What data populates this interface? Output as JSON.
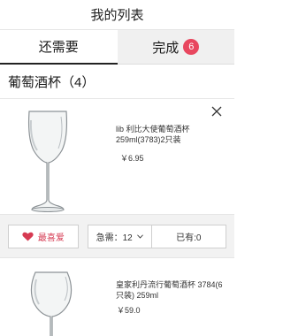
{
  "header": {
    "title": "我的列表"
  },
  "tabs": [
    {
      "label": "还需要",
      "active": true
    },
    {
      "label": "完成",
      "badge": "6",
      "active": false
    }
  ],
  "section": {
    "title": "葡萄酒杯（4）"
  },
  "items": [
    {
      "name": "lib 利比大使葡萄酒杯 259ml(3783)2只装",
      "price": "￥6.95",
      "icon": "wine-glass-icon"
    },
    {
      "name": "皇家利丹流行葡萄酒杯 3784(6只装) 259ml",
      "price": "￥59.0",
      "icon": "wine-glass-icon"
    }
  ],
  "actions": {
    "favorite_label": "最喜爱",
    "need_label": "急需：12",
    "have_label": "已有:0"
  },
  "colors": {
    "accent": "#e8475f",
    "favorite": "#d63a52"
  }
}
